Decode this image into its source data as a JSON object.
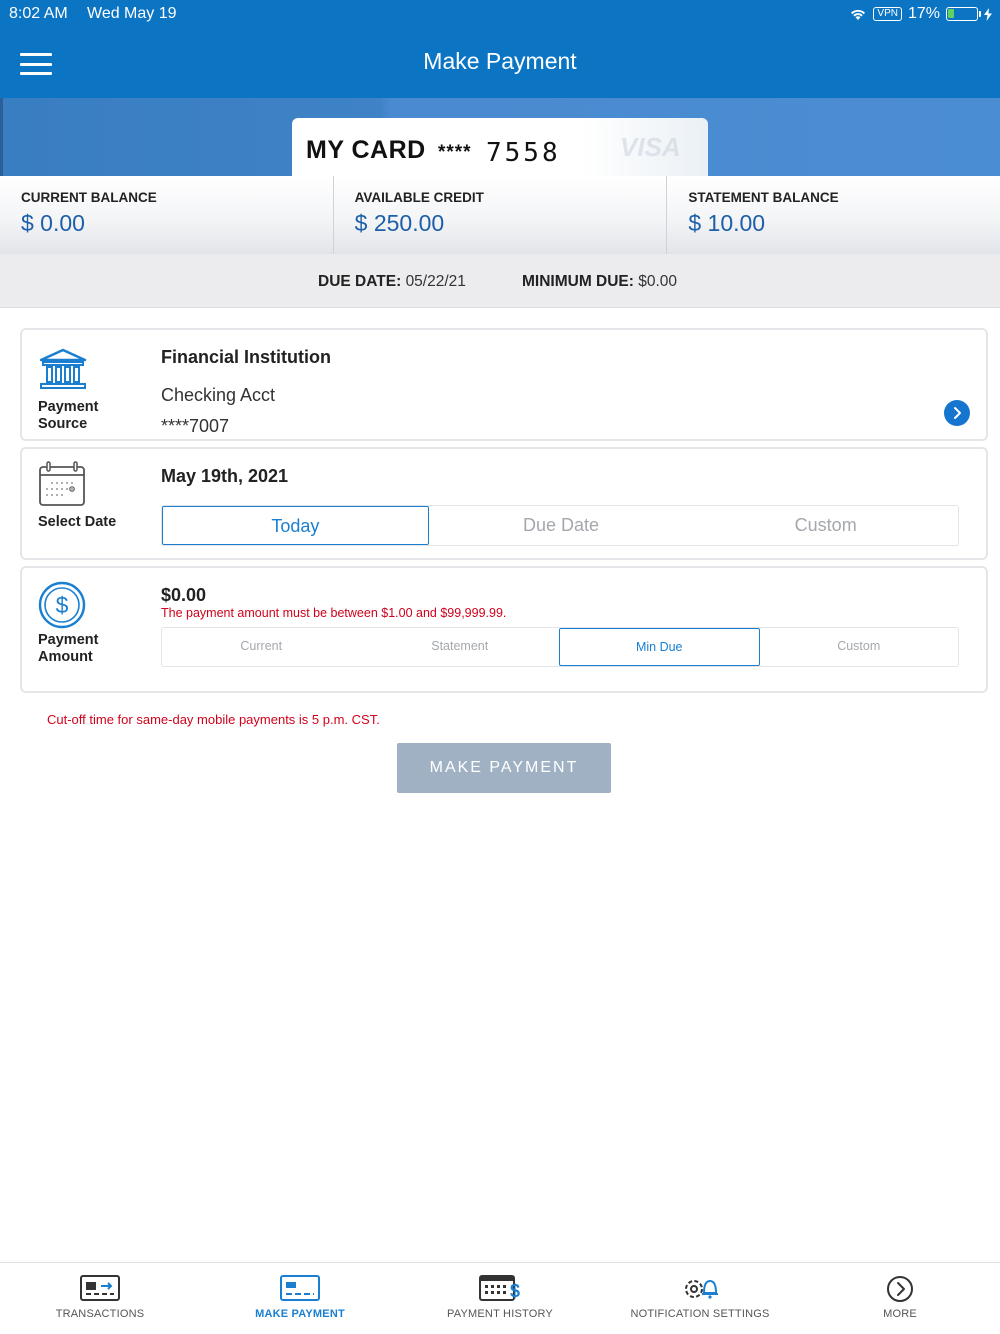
{
  "status_bar": {
    "time": "8:02 AM",
    "date": "Wed May 19",
    "vpn": "VPN",
    "battery": "17%"
  },
  "header": {
    "title": "Make Payment"
  },
  "card": {
    "name": "MY CARD",
    "mask": "****",
    "last4": "7558",
    "watermark": "VISA"
  },
  "balances": {
    "current_label": "CURRENT BALANCE",
    "current_value": "$ 0.00",
    "available_label": "AVAILABLE CREDIT",
    "available_value": "$ 250.00",
    "statement_label": "STATEMENT BALANCE",
    "statement_value": "$ 10.00"
  },
  "due": {
    "due_date_label": "DUE DATE:",
    "due_date_value": "05/22/21",
    "min_due_label": "MINIMUM DUE:",
    "min_due_value": "$0.00"
  },
  "payment_source": {
    "caption_line1": "Payment",
    "caption_line2": "Source",
    "institution": "Financial Institution",
    "account_type": "Checking Acct",
    "account_number": "****7007"
  },
  "select_date": {
    "caption": "Select Date",
    "selected_date": "May 19th, 2021",
    "options": [
      "Today",
      "Due Date",
      "Custom"
    ]
  },
  "payment_amount": {
    "caption_line1": "Payment",
    "caption_line2": "Amount",
    "value": "$0.00",
    "error": "The payment amount must be between $1.00 and $99,999.99.",
    "options": [
      "Current",
      "Statement",
      "Min Due",
      "Custom"
    ]
  },
  "cutoff_notice": "Cut-off time for same-day mobile payments is 5 p.m. CST.",
  "make_payment_button": "MAKE PAYMENT",
  "tabbar": {
    "items": [
      "TRANSACTIONS",
      "MAKE PAYMENT",
      "PAYMENT HISTORY",
      "NOTIFICATION SETTINGS",
      "MORE"
    ],
    "active": "MAKE PAYMENT"
  },
  "colors": {
    "brand_blue": "#0b75c4",
    "accent_blue": "#1a7fd1",
    "error_red": "#d0021b",
    "disabled_button": "#a0b1c4"
  }
}
